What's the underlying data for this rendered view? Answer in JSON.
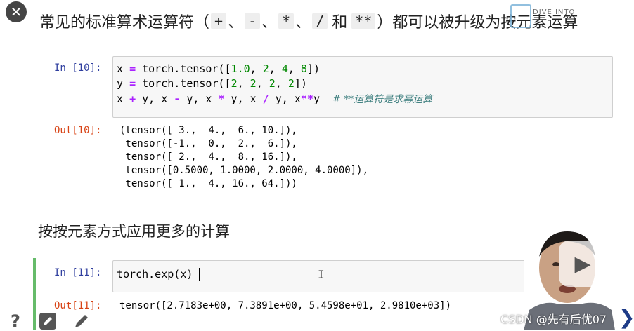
{
  "toolbar": {
    "close_glyph": "✕",
    "help_glyph": "?",
    "next_glyph": "❯"
  },
  "logo": {
    "text": "DIVE INTO"
  },
  "heading1": {
    "prefix": "常见的标准算术运算符（",
    "ops": [
      "+",
      "-",
      "*",
      "/",
      "**"
    ],
    "sep": "、",
    "and_word": "和",
    "suffix": "）都可以被升级为按元素运算"
  },
  "cell1": {
    "prompt": "In [10]:",
    "line1": {
      "a": "x ",
      "b": "=",
      "c": " torch.tensor([",
      "n1": "1.0",
      "d": ", ",
      "n2": "2",
      "e": ", ",
      "n3": "4",
      "f": ", ",
      "n4": "8",
      "g": "])"
    },
    "line2": {
      "a": "y ",
      "b": "=",
      "c": " torch.tensor([",
      "n1": "2",
      "d": ", ",
      "n2": "2",
      "e": ", ",
      "n3": "2",
      "f": ", ",
      "n4": "2",
      "g": "])"
    },
    "line3": {
      "p1": "x ",
      "o1": "+",
      "p2": " y, x ",
      "o2": "-",
      "p3": " y, x ",
      "o3": "*",
      "p4": " y, x ",
      "o4": "/",
      "p5": " y, x",
      "o5": "**",
      "p6": "y",
      "comment": "# **运算符是求幂运算"
    }
  },
  "out1": {
    "prompt": "Out[10]:",
    "lines": [
      "(tensor([ 3.,  4.,  6., 10.]),",
      " tensor([-1.,  0.,  2.,  6.]),",
      " tensor([ 2.,  4.,  8., 16.]),",
      " tensor([0.5000, 1.0000, 2.0000, 4.0000]),",
      " tensor([ 1.,  4., 16., 64.]))"
    ]
  },
  "heading2": {
    "text": "按按元素方式应用更多的计算"
  },
  "cell2": {
    "prompt": "In [11]:",
    "code_a": "torch.exp(",
    "code_b": "x",
    "code_c": ")"
  },
  "out2": {
    "prompt": "Out[11]:",
    "line": "tensor([2.7183e+00, 7.3891e+00, 5.4598e+01, 2.9810e+03])"
  },
  "watermark": {
    "text": "CSDN @先有后优07"
  },
  "colors": {
    "in_prompt": "#303f9f",
    "out_prompt": "#d84315",
    "number": "#008800",
    "operator": "#aa22ff",
    "comment": "#408080",
    "active_cell_bar": "#66bb6a"
  }
}
